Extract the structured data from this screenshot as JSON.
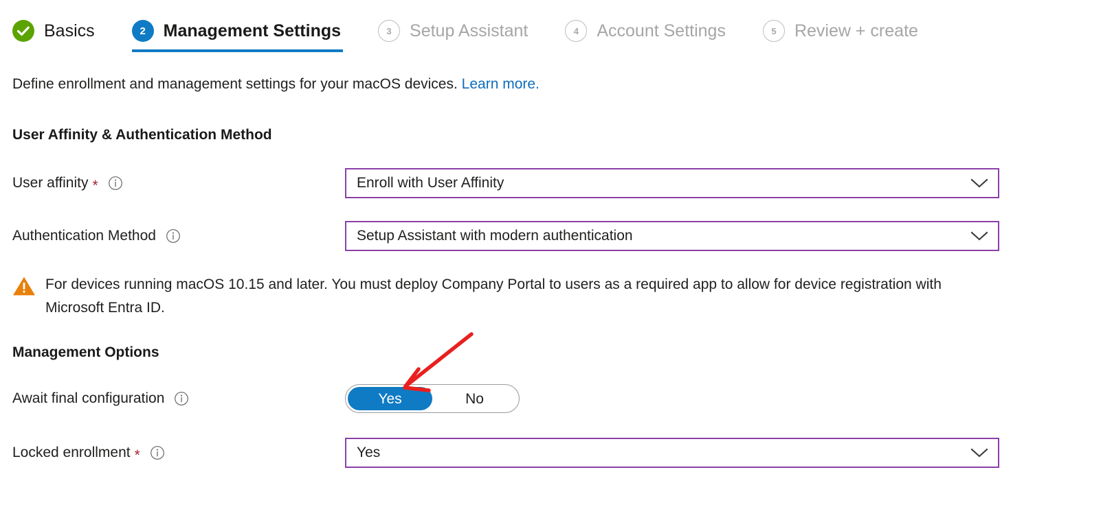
{
  "wizard": {
    "tabs": [
      {
        "marker": "check",
        "label": "Basics",
        "state": "done"
      },
      {
        "marker": "2",
        "label": "Management Settings",
        "state": "current"
      },
      {
        "marker": "3",
        "label": "Setup Assistant",
        "state": "pending"
      },
      {
        "marker": "4",
        "label": "Account Settings",
        "state": "pending"
      },
      {
        "marker": "5",
        "label": "Review + create",
        "state": "pending"
      }
    ]
  },
  "description": {
    "text": "Define enrollment and management settings for your macOS devices.",
    "link_text": "Learn more."
  },
  "sections": {
    "user_affinity": {
      "heading": "User Affinity & Authentication Method",
      "fields": {
        "user_affinity": {
          "label": "User affinity",
          "required": true,
          "info_icon": "info-icon",
          "value": "Enroll with User Affinity",
          "control": "dropdown"
        },
        "authentication_method": {
          "label": "Authentication Method",
          "required": false,
          "info_icon": "info-icon",
          "value": "Setup Assistant with modern authentication",
          "control": "dropdown"
        }
      },
      "warning": {
        "icon": "warning-triangle-icon",
        "text": "For devices running macOS 10.15 and later. You must deploy Company Portal to users as a required app to allow for device registration with Microsoft Entra ID."
      }
    },
    "management_options": {
      "heading": "Management Options",
      "fields": {
        "await_final_configuration": {
          "label": "Await final configuration",
          "required": false,
          "info_icon": "info-icon",
          "control": "toggle",
          "options": [
            "Yes",
            "No"
          ],
          "selected": "Yes"
        },
        "locked_enrollment": {
          "label": "Locked enrollment",
          "required": true,
          "info_icon": "info-icon",
          "value": "Yes",
          "control": "dropdown"
        }
      }
    }
  },
  "annotation": {
    "type": "arrow",
    "color": "#E8201F",
    "points_to": "await-final-configuration-toggle-yes"
  },
  "colors": {
    "accent_blue": "#0F7BC4",
    "success_green": "#5BA300",
    "link_blue": "#0F6CBD",
    "field_border_purple": "#8B3FA8",
    "required_red": "#a4262c",
    "warning_orange": "#E8800C",
    "annotation_red": "#E8201F",
    "pending_gray": "#a6a6a6"
  },
  "icons": {
    "check": "check-icon",
    "chevron_down": "chevron-down-icon",
    "info": "info-icon",
    "warning": "warning-triangle-icon"
  }
}
